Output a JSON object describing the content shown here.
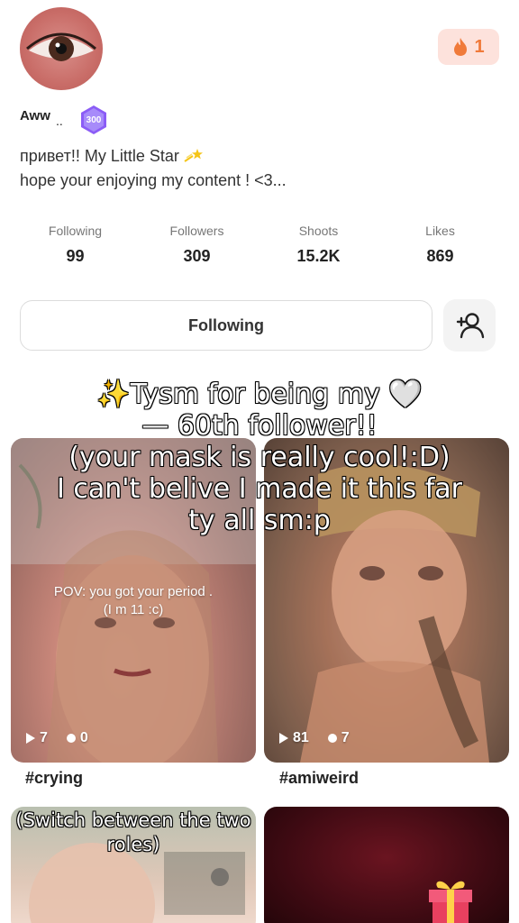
{
  "profile": {
    "name": "Aww",
    "name_suffix": "..",
    "level_badge": "300",
    "bio_line1": "привет!! My Little Star",
    "bio_line2": "hope your enjoying my content ! <3...",
    "streak_count": "1"
  },
  "stats": [
    {
      "label": "Following",
      "value": "99"
    },
    {
      "label": "Followers",
      "value": "309"
    },
    {
      "label": "Shoots",
      "value": "15.2K"
    },
    {
      "label": "Likes",
      "value": "869"
    }
  ],
  "actions": {
    "following_label": "Following"
  },
  "overlay": {
    "line1": "✨Tysm for being my 🤍",
    "line2": "— 60th follower!!",
    "line3": "(your mask is really cool!:D)",
    "line4": "I can't belive I made it this far",
    "line5": "ty all sm:p"
  },
  "tiles": [
    {
      "caption": "POV: you got your period .",
      "caption2": "(I m 11 :c)",
      "views": "7",
      "comments": "0",
      "tag": "#crying"
    },
    {
      "views": "81",
      "comments": "7",
      "tag": "#amiweird"
    },
    {
      "caption": "(Switch between the two roles)"
    },
    {}
  ],
  "colors": {
    "accent_streak": "#f07a3a",
    "streak_bg": "#fde2dc",
    "level_badge": "#8b5cf6"
  },
  "icons": {
    "streak": "flame-icon",
    "level": "hexagon-badge-icon",
    "add_friend": "add-friend-icon",
    "play": "play-icon",
    "comment": "comment-icon",
    "gift": "gift-icon"
  }
}
